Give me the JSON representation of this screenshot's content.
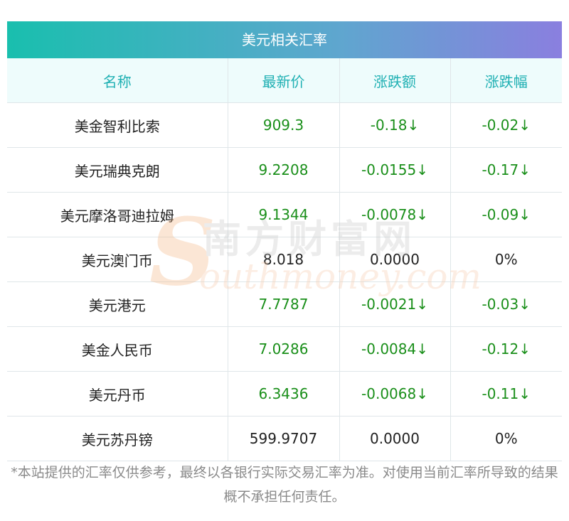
{
  "header": {
    "title": "美元相关汇率"
  },
  "table": {
    "columns": [
      "名称",
      "最新价",
      "涨跌额",
      "涨跌幅"
    ],
    "rows": [
      {
        "name": "美金智利比索",
        "price": "909.3",
        "change": "-0.18↓",
        "pct": "-0.02↓",
        "dir": "down"
      },
      {
        "name": "美元瑞典克朗",
        "price": "9.2208",
        "change": "-0.0155↓",
        "pct": "-0.17↓",
        "dir": "down"
      },
      {
        "name": "美元摩洛哥迪拉姆",
        "price": "9.1344",
        "change": "-0.0078↓",
        "pct": "-0.09↓",
        "dir": "down"
      },
      {
        "name": "美元澳门币",
        "price": "8.018",
        "change": "0.0000",
        "pct": "0%",
        "dir": "flat"
      },
      {
        "name": "美元港元",
        "price": "7.7787",
        "change": "-0.0021↓",
        "pct": "-0.03↓",
        "dir": "down"
      },
      {
        "name": "美金人民币",
        "price": "7.0286",
        "change": "-0.0084↓",
        "pct": "-0.12↓",
        "dir": "down"
      },
      {
        "name": "美元丹币",
        "price": "6.3436",
        "change": "-0.0068↓",
        "pct": "-0.11↓",
        "dir": "down"
      },
      {
        "name": "美元苏丹镑",
        "price": "599.9707",
        "change": "0.0000",
        "pct": "0%",
        "dir": "flat"
      }
    ]
  },
  "watermark": {
    "brand_cn": "南方财富网",
    "brand_en": "Southmoney.com"
  },
  "footer": {
    "disclaimer": "*本站提供的汇率仅供参考，最终以各银行实际交易汇率为准。对使用当前汇率所导致的结果概不承担任何责任。"
  },
  "colors": {
    "accent_start": "#19bfae",
    "accent_end": "#8a7fdf",
    "header_text": "#1fb0b3",
    "down": "#1a8f1a"
  }
}
